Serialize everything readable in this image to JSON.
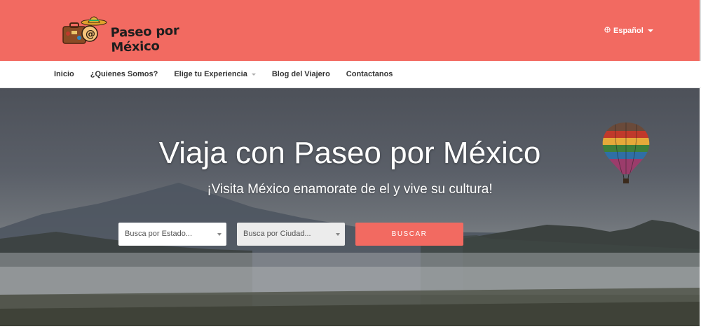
{
  "brand": {
    "name": "Paseo por México"
  },
  "header": {
    "language_label": "Español"
  },
  "nav": {
    "items": [
      {
        "label": "Inicio"
      },
      {
        "label": "¿Quienes Somos?"
      },
      {
        "label": "Elige tu Experiencia"
      },
      {
        "label": "Blog del Viajero"
      },
      {
        "label": "Contactanos"
      }
    ]
  },
  "hero": {
    "title": "Viaja con Paseo por México",
    "subtitle": "¡Visita México enamorate de el y vive su cultura!",
    "search": {
      "estado_placeholder": "Busca por Estado...",
      "ciudad_placeholder": "Busca por Ciudad...",
      "button_label": "BUSCAR"
    }
  },
  "colors": {
    "brand_accent": "#f26a61",
    "nav_bg": "#ffffff"
  },
  "icons": [
    "suitcase-logo-icon",
    "sombrero-icon",
    "globe-icon",
    "caret-down-icon",
    "hot-air-balloon-icon"
  ]
}
